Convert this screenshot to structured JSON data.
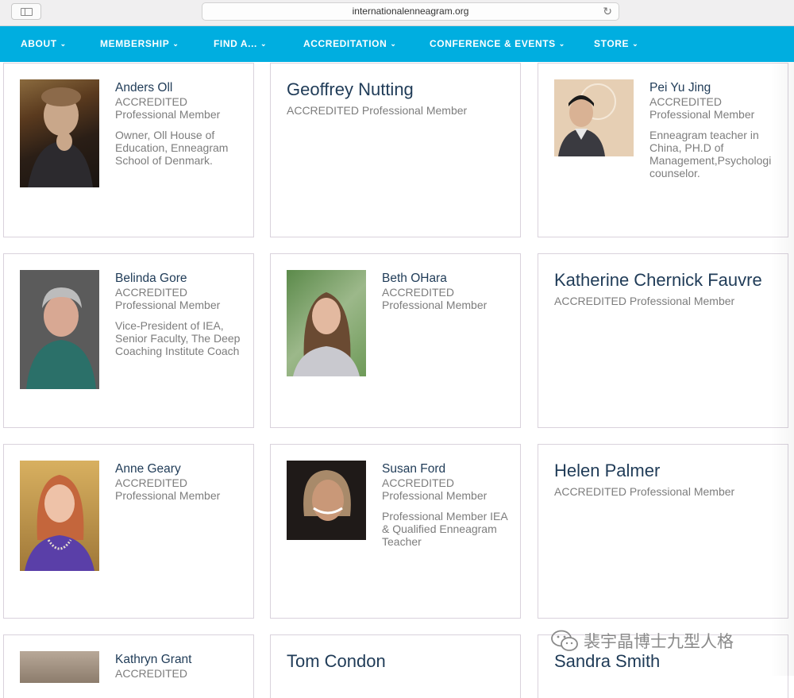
{
  "browser": {
    "url": "internationalenneagram.org"
  },
  "nav": {
    "items": [
      "ABOUT",
      "MEMBERSHIP",
      "FIND A...",
      "ACCREDITATION",
      "CONFERENCE & EVENTS",
      "STORE"
    ]
  },
  "cards": [
    {
      "name": "Anders Oll",
      "line1": "ACCREDITED",
      "line2": "Professional Member",
      "desc": "Owner, Oll House of Education, Enneagram School of Denmark."
    },
    {
      "name": "Geoffrey Nutting",
      "sub": "ACCREDITED Professional Member"
    },
    {
      "name": "Pei Yu Jing",
      "line1": "ACCREDITED",
      "line2": "Professional Member",
      "desc": "Enneagram teacher in China, PH.D of Management,Psychologi counselor."
    },
    {
      "name": "Belinda Gore",
      "line1": "ACCREDITED",
      "line2": "Professional Member",
      "desc": "Vice-President of IEA, Senior Faculty, The Deep Coaching Institute Coach"
    },
    {
      "name": "Beth OHara",
      "line1": "ACCREDITED",
      "line2": "Professional Member"
    },
    {
      "name": "Katherine Chernick Fauvre",
      "sub": "ACCREDITED Professional Member"
    },
    {
      "name": "Anne Geary",
      "line1": "ACCREDITED",
      "line2": "Professional Member"
    },
    {
      "name": "Susan Ford",
      "line1": "ACCREDITED",
      "line2": "Professional Member",
      "desc": "Professional Member IEA & Qualified Enneagram Teacher"
    },
    {
      "name": "Helen Palmer",
      "sub": "ACCREDITED Professional Member"
    },
    {
      "name": "Kathryn Grant",
      "line1": "ACCREDITED"
    },
    {
      "name": "Tom Condon"
    },
    {
      "name": "Sandra Smith"
    }
  ],
  "watermark": {
    "text": "裴宇晶博士九型人格",
    "icon": "wechat-icon"
  },
  "colors": {
    "nav": "#00aee0",
    "name": "#1f3b57",
    "text": "#7d7d7d",
    "border": "#d9d2dc"
  }
}
